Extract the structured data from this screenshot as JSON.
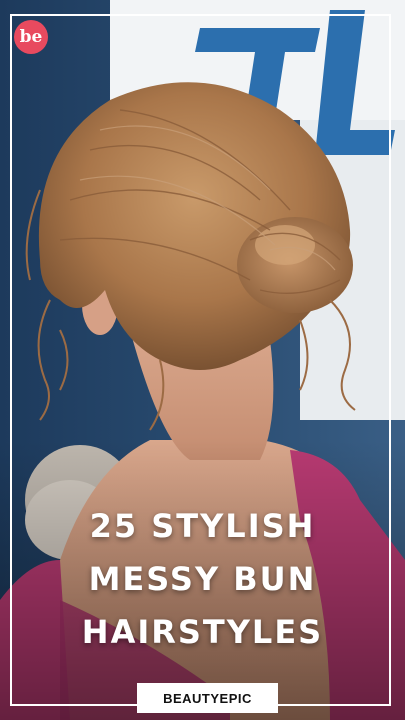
{
  "brand": {
    "logo_text": "be",
    "logo_color": "#e84a5f",
    "badge_label": "BEAUTYEPIC"
  },
  "headline": {
    "line1": "25 STYLISH",
    "line2": "MESSY BUN",
    "line3": "HAIRSTYLES"
  },
  "photo": {
    "background_sign_text": "TL",
    "subject": "woman with messy bun, back view"
  }
}
